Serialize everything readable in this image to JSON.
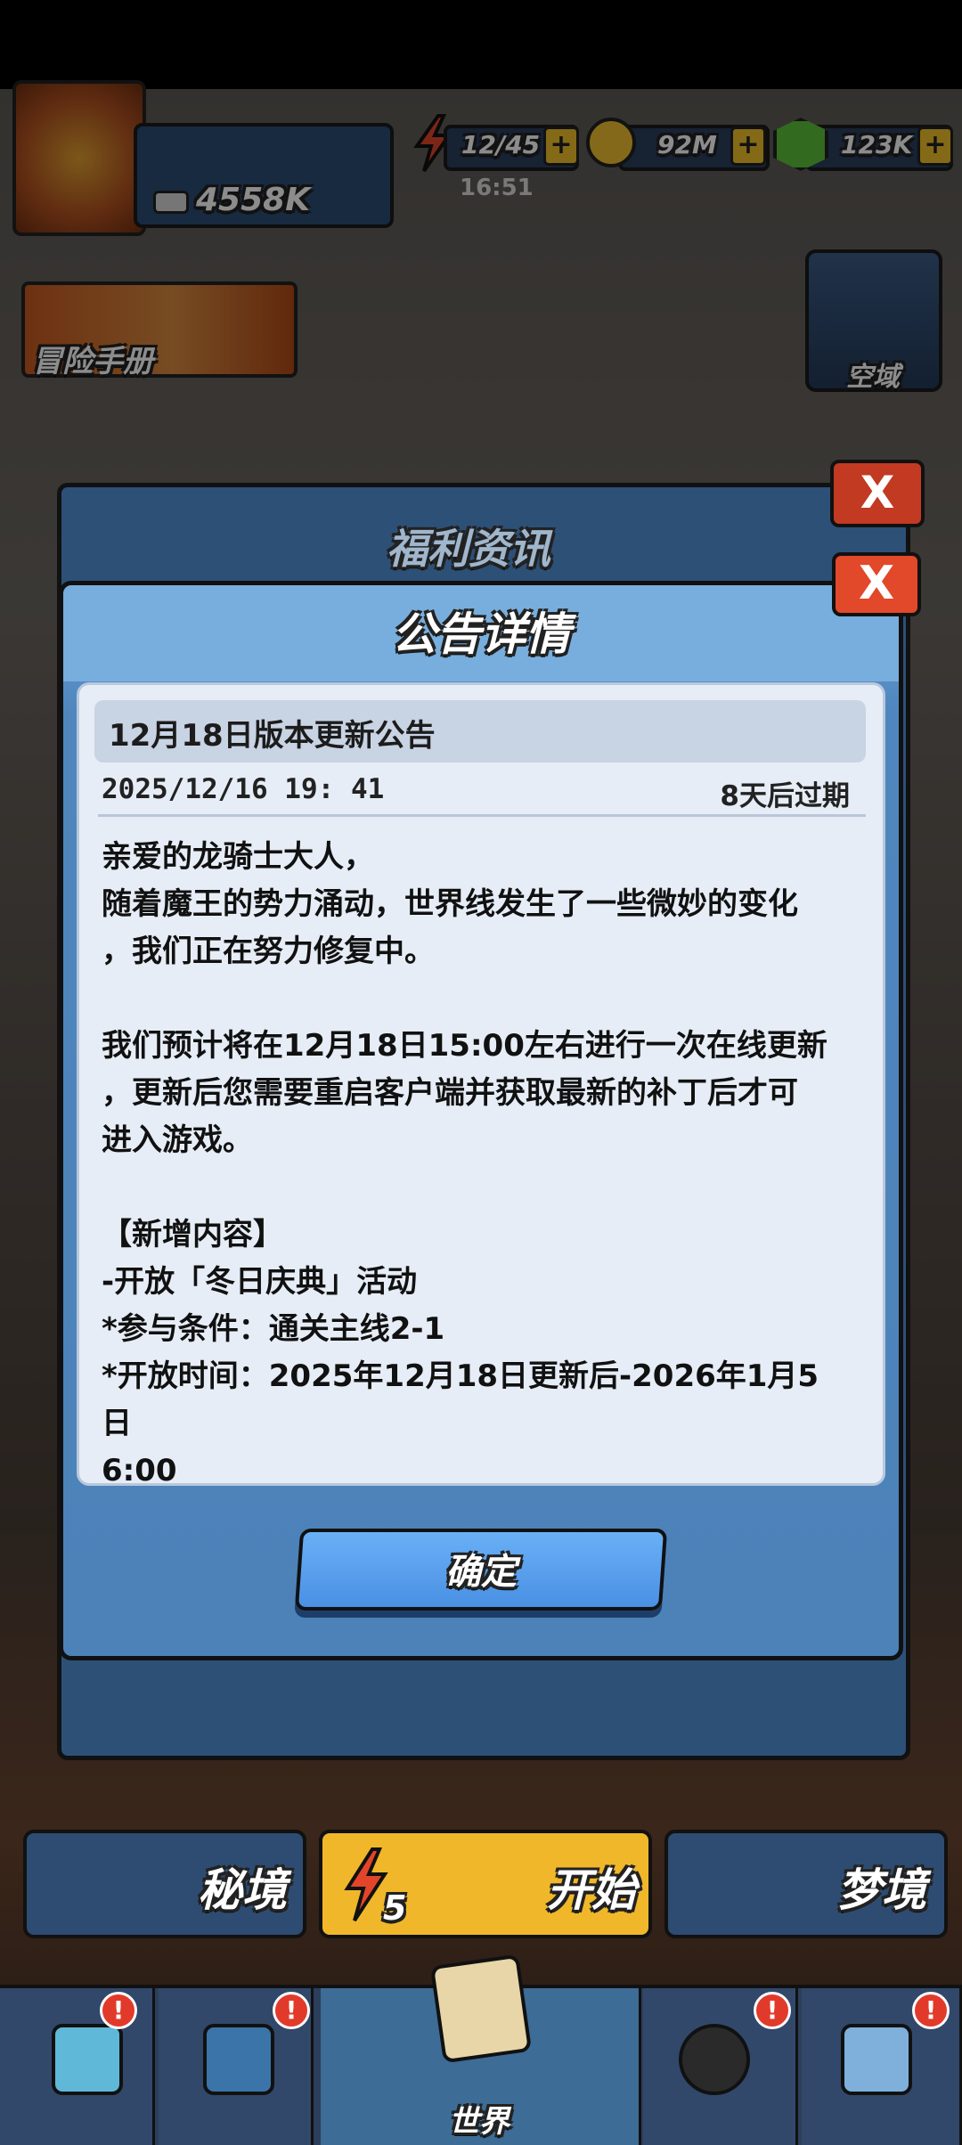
{
  "hud": {
    "power": "4558K",
    "energy": "12/45",
    "energy_timer": "16:51",
    "coins": "92M",
    "gems": "123K",
    "plus": "+"
  },
  "side": {
    "manual": "冒险手册",
    "airspace": "空域"
  },
  "under_dialog": {
    "title": "福利资讯",
    "close": "X"
  },
  "dialog": {
    "title": "公告详情",
    "close": "X",
    "notice_title": "12月18日版本更新公告",
    "date": "2025/12/16 19: 41",
    "expire": "8天后过期",
    "body": "亲爱的龙骑士大人，\n随着魔王的势力涌动，世界线发生了一些微妙的变化\n，我们正在努力修复中。\n\n我们预计将在12月18日15:00左右进行一次在线更新\n，更新后您需要重启客户端并获取最新的补丁后才可\n进入游戏。\n\n【新增内容】\n-开放「冬日庆典」活动\n*参与条件：通关主线2-1\n*开放时间：2025年12月18日更新后-2026年1月5日\n6:00",
    "confirm": "确定"
  },
  "modes": {
    "secret": "秘境",
    "start": "开始",
    "start_cost": "5",
    "dream": "梦境"
  },
  "nav": {
    "world": "世界",
    "badge": "!"
  },
  "colors": {
    "dialog_blue": "#4f86bd",
    "close_red": "#e2482a",
    "confirm_blue": "#5aa0ee",
    "start_yellow": "#f1b72a"
  }
}
